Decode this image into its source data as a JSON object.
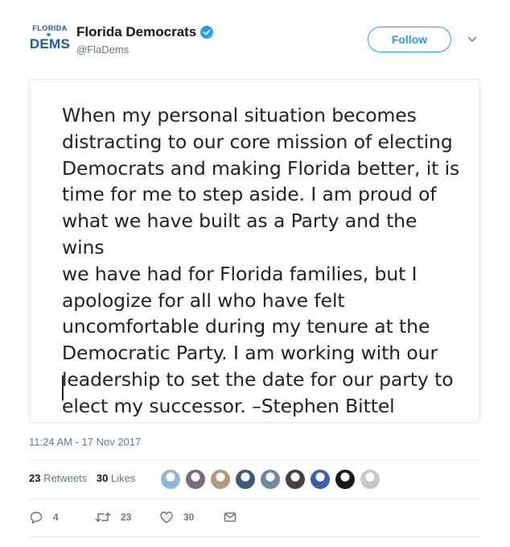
{
  "account": {
    "logo_top": "FLORIDA",
    "logo_bottom": "DEMS",
    "display_name": "Florida Democrats",
    "verified_icon": "verified-badge-icon",
    "handle": "@FlaDems"
  },
  "header": {
    "follow_label": "Follow",
    "more_icon": "chevron-down-icon"
  },
  "media": {
    "statement": "When my personal situation becomes\ndistracting to our core mission of electing\nDemocrats and making Florida better, it is\ntime for me to step aside.  I am proud of\nwhat we have built as a Party and the wins\nwe have had for Florida families, but I\napologize for all who have felt\nuncomfortable during my tenure at the\nDemocratic Party.  I am working with our\nleadership to set the date for our party to\nelect my successor. –Stephen Bittel"
  },
  "tweet": {
    "timestamp": "11:24 AM - 17 Nov 2017"
  },
  "stats": {
    "retweets_count": "23",
    "retweets_label": "Retweets",
    "likes_count": "30",
    "likes_label": "Likes",
    "liker_avatars": [
      {
        "color": "#8fb8d8"
      },
      {
        "color": "#7a6a7e"
      },
      {
        "color": "#b09a7a"
      },
      {
        "color": "#3c5a7a"
      },
      {
        "color": "#6c8aa0"
      },
      {
        "color": "#4a4040"
      },
      {
        "color": "#3a5ea8"
      },
      {
        "color": "#1a1a1a"
      },
      {
        "color": "#c8c8c8"
      }
    ]
  },
  "actions": {
    "reply_count": "4",
    "retweet_count": "23",
    "like_count": "30",
    "reply_icon": "reply-icon",
    "retweet_icon": "retweet-icon",
    "like_icon": "heart-icon",
    "message_icon": "direct-message-icon"
  },
  "colors": {
    "accent": "#1da1f2",
    "secondary_text": "#657786",
    "logo_blue": "#1c5aa6"
  }
}
